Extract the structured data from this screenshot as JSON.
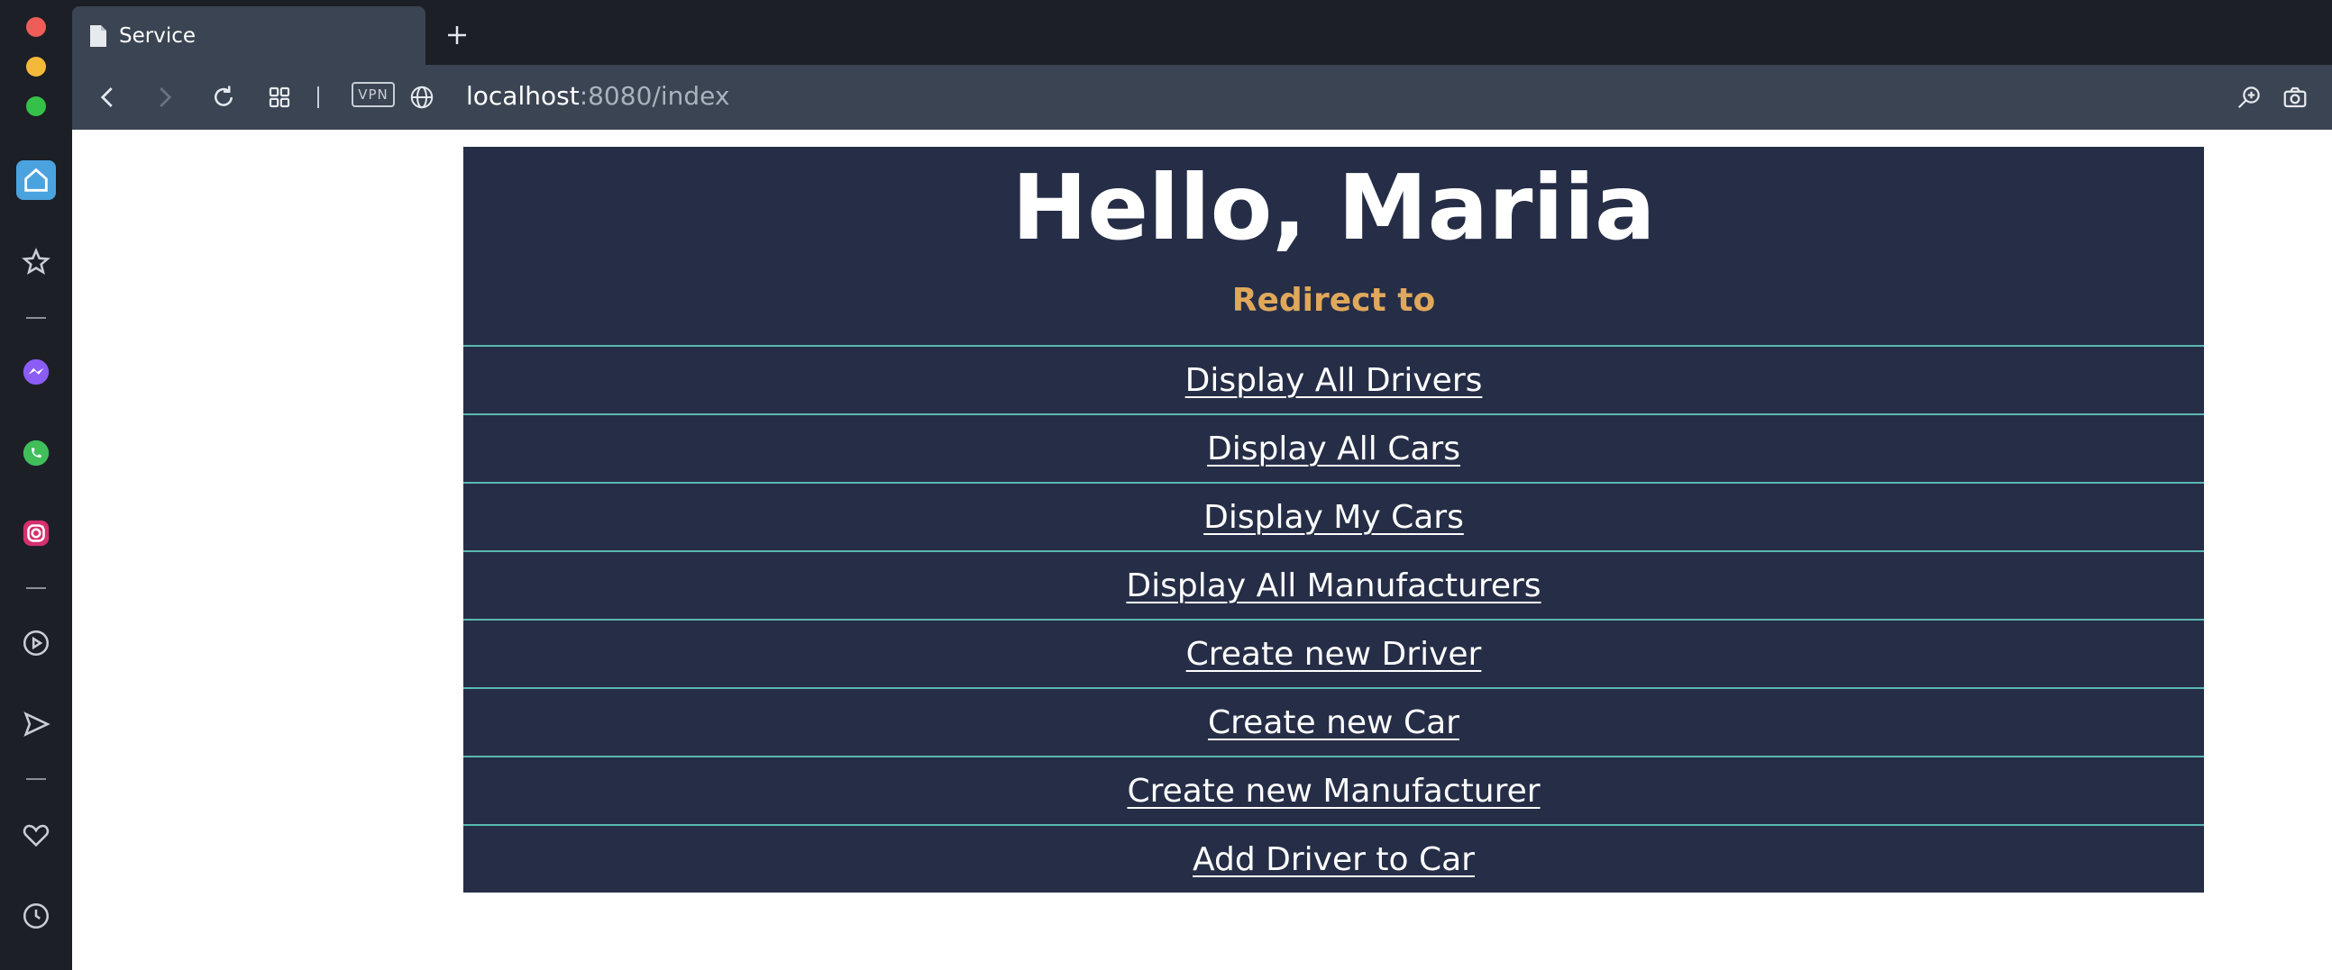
{
  "browser": {
    "tab_title": "Service",
    "url_host": "localhost",
    "url_rest": ":8080/index",
    "vpn_label": "VPN",
    "traffic_colors": [
      "#ee5d58",
      "#f5b93a",
      "#35c149"
    ]
  },
  "sidebar": {
    "items": [
      {
        "icon": "home-icon"
      },
      {
        "icon": "star-icon"
      },
      {
        "icon": "messenger-icon"
      },
      {
        "icon": "whatsapp-icon"
      },
      {
        "icon": "instagram-icon"
      },
      {
        "icon": "player-icon"
      },
      {
        "icon": "send-icon"
      },
      {
        "icon": "heart-icon"
      },
      {
        "icon": "history-icon"
      }
    ]
  },
  "page": {
    "greeting": "Hello, Mariia",
    "subtitle": "Redirect to",
    "links": [
      "Display All Drivers",
      "Display All Cars",
      "Display My Cars",
      "Display All Manufacturers",
      "Create new Driver",
      "Create new Car",
      "Create new Manufacturer",
      "Add Driver to Car"
    ],
    "colors": {
      "panel_bg": "#262e47",
      "subtitle": "#e0a85a",
      "row_border": "#5ab8b0"
    }
  }
}
